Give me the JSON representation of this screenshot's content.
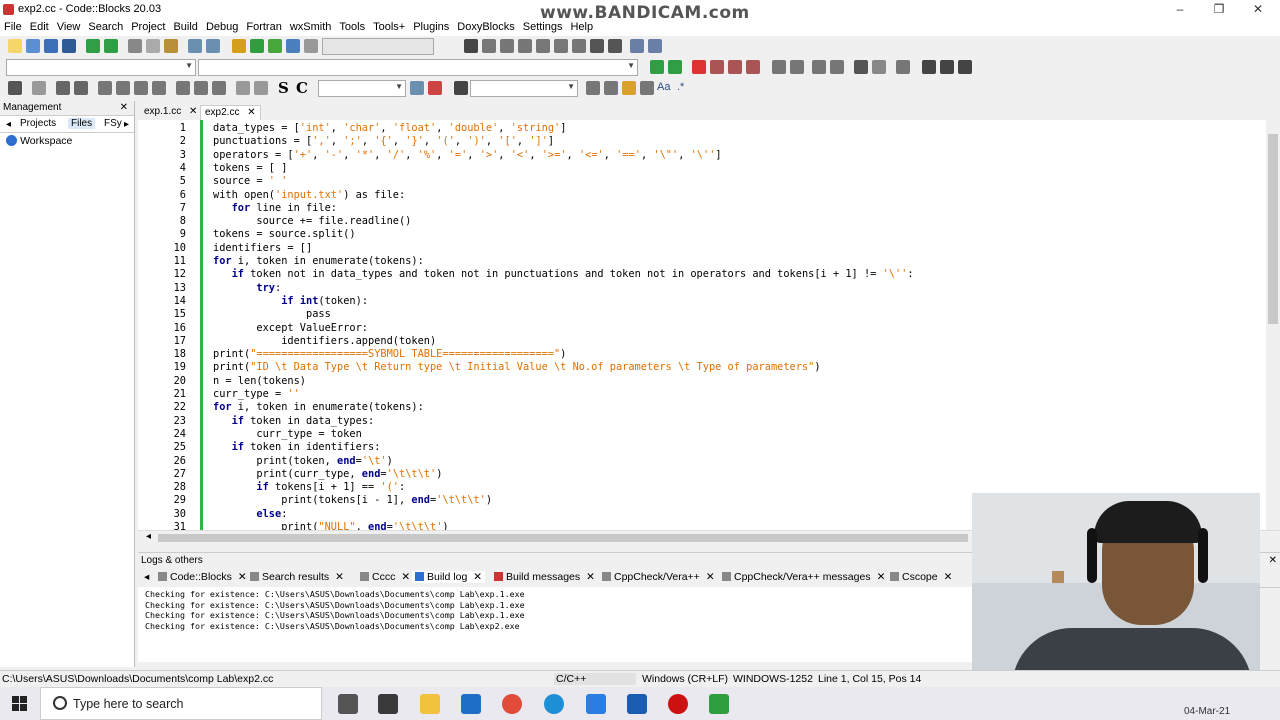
{
  "window": {
    "title": "exp2.cc - Code::Blocks 20.03",
    "min": "–",
    "max": "❐",
    "close": "✕"
  },
  "watermark": "www.BANDICAM.com",
  "menu": [
    "File",
    "Edit",
    "View",
    "Search",
    "Project",
    "Build",
    "Debug",
    "Fortran",
    "wxSmith",
    "Tools",
    "Tools+",
    "Plugins",
    "DoxyBlocks",
    "Settings",
    "Help"
  ],
  "toolbar3": {
    "bold_s": "S",
    "bold_c": "C",
    "aa": "Aa",
    "star": ".*"
  },
  "management": {
    "title": "Management",
    "close": "✕",
    "tabs": [
      "Projects",
      "Files",
      "FSy"
    ],
    "tree_root": "Workspace"
  },
  "editor": {
    "tabs": [
      {
        "label": "exp.1.cc"
      },
      {
        "label": "exp2.cc"
      }
    ],
    "close": "✕",
    "lines": [
      {
        "n": "1",
        "html": "data_types = [<span class=\"str\">'int'</span>, <span class=\"str\">'char'</span>, <span class=\"str\">'float'</span>, <span class=\"str\">'double'</span>, <span class=\"str\">'string'</span>]"
      },
      {
        "n": "2",
        "html": "punctuations = [<span class=\"str\">','</span>, <span class=\"str\">';'</span>, <span class=\"str\">'{'</span>, <span class=\"str\">'}'</span>, <span class=\"str\">'('</span>, <span class=\"str\">')'</span>, <span class=\"str\">'['</span>, <span class=\"str\">']'</span>]"
      },
      {
        "n": "3",
        "html": "operators = [<span class=\"str\">'+'</span>, <span class=\"str\">'-'</span>, <span class=\"str\">'*'</span>, <span class=\"str\">'/'</span>, <span class=\"str\">'%'</span>, <span class=\"str\">'='</span>, <span class=\"str\">'&gt;'</span>, <span class=\"str\">'&lt;'</span>, <span class=\"str\">'&gt;='</span>, <span class=\"str\">'&lt;='</span>, <span class=\"str\">'=='</span>, <span class=\"str\">'\\\"'</span>, <span class=\"str\">'\\''</span>]"
      },
      {
        "n": "4",
        "html": "tokens = [ ]"
      },
      {
        "n": "5",
        "html": "source = <span class=\"str\">' '</span>"
      },
      {
        "n": "6",
        "html": "with open(<span class=\"str\">'input.txt'</span>) as file:"
      },
      {
        "n": "7",
        "html": "   <span class=\"kw\">for</span> line in file:"
      },
      {
        "n": "8",
        "html": "       source += file.readline()"
      },
      {
        "n": "9",
        "html": "tokens = source.split()"
      },
      {
        "n": "10",
        "html": "identifiers = []"
      },
      {
        "n": "11",
        "html": "<span class=\"kw\">for</span> i, token in enumerate(tokens):"
      },
      {
        "n": "12",
        "html": "   <span class=\"kw\">if</span> token not in data_types and token not in punctuations and token not in operators and tokens[i + 1] != <span class=\"str\">'\\''</span>:"
      },
      {
        "n": "13",
        "html": "       <span class=\"kw\">try</span>:"
      },
      {
        "n": "14",
        "html": "           <span class=\"kw\">if</span> <span class=\"kw\">int</span>(token):"
      },
      {
        "n": "15",
        "html": "               pass"
      },
      {
        "n": "16",
        "html": "       except ValueError:"
      },
      {
        "n": "17",
        "html": "           identifiers.append(token)"
      },
      {
        "n": "18",
        "html": "print(<span class=\"str\">\"==================SYBMOL TABLE==================\"</span>)"
      },
      {
        "n": "19",
        "html": "print(<span class=\"str\">\"ID \\t Data Type \\t Return type \\t Initial Value \\t No.of parameters \\t Type of parameters\"</span>)"
      },
      {
        "n": "20",
        "html": "n = len(tokens)"
      },
      {
        "n": "21",
        "html": "curr_type = <span class=\"str\">''</span>"
      },
      {
        "n": "22",
        "html": "<span class=\"kw\">for</span> i, token in enumerate(tokens):"
      },
      {
        "n": "23",
        "html": "   <span class=\"kw\">if</span> token in data_types:"
      },
      {
        "n": "24",
        "html": "       curr_type = token"
      },
      {
        "n": "25",
        "html": "   <span class=\"kw\">if</span> token in identifiers:"
      },
      {
        "n": "26",
        "html": "       print(token, <span class=\"kw\">end</span>=<span class=\"str\">'\\t'</span>)"
      },
      {
        "n": "27",
        "html": "       print(curr_type, <span class=\"kw\">end</span>=<span class=\"str\">'\\t\\t\\t'</span>)"
      },
      {
        "n": "28",
        "html": "       <span class=\"kw\">if</span> tokens[i + 1] == <span class=\"str\">'('</span>:"
      },
      {
        "n": "29",
        "html": "           print(tokens[i - 1], <span class=\"kw\">end</span>=<span class=\"str\">'\\t\\t\\t'</span>)"
      },
      {
        "n": "30",
        "html": "       <span class=\"kw\">else</span>:"
      },
      {
        "n": "31",
        "html": "           print(<span class=\"str\">\"NULL\"</span>, <span class=\"kw\">end</span>=<span class=\"str\">'\\t\\t\\t'</span>)"
      }
    ]
  },
  "logs": {
    "title": "Logs & others",
    "close": "✕",
    "tabs": [
      "Code::Blocks",
      "Search results",
      "Cccc",
      "Build log",
      "Build messages",
      "CppCheck/Vera++",
      "CppCheck/Vera++ messages",
      "Cscope"
    ],
    "lines": [
      "Checking for existence: C:\\Users\\ASUS\\Downloads\\Documents\\comp Lab\\exp.1.exe",
      "Checking for existence: C:\\Users\\ASUS\\Downloads\\Documents\\comp Lab\\exp.1.exe",
      "Checking for existence: C:\\Users\\ASUS\\Downloads\\Documents\\comp Lab\\exp.1.exe",
      "Checking for existence: C:\\Users\\ASUS\\Downloads\\Documents\\comp Lab\\exp2.exe"
    ]
  },
  "status": {
    "path": "C:\\Users\\ASUS\\Downloads\\Documents\\comp Lab\\exp2.cc",
    "lang": "C/C++",
    "eol": "Windows (CR+LF)",
    "encoding": "WINDOWS-1252",
    "position": "Line 1, Col 15, Pos 14"
  },
  "taskbar": {
    "search_placeholder": "Type here to search",
    "date": "04-Mar-21"
  },
  "colors": {
    "string": "#e07000",
    "keyword": "#00008b",
    "changebar": "#2db742"
  }
}
